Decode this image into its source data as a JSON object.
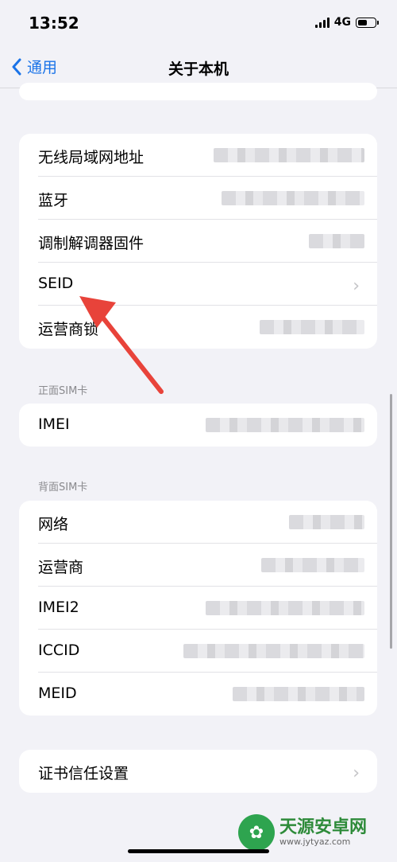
{
  "status": {
    "time": "13:52",
    "network": "4G"
  },
  "nav": {
    "back_label": "通用",
    "title": "关于本机"
  },
  "group1": {
    "rows": [
      {
        "label": "无线局域网地址"
      },
      {
        "label": "蓝牙"
      },
      {
        "label": "调制解调器固件"
      },
      {
        "label": "SEID"
      },
      {
        "label": "运营商锁"
      }
    ]
  },
  "section_front": "正面SIM卡",
  "group2": {
    "rows": [
      {
        "label": "IMEI"
      }
    ]
  },
  "section_back": "背面SIM卡",
  "group3": {
    "rows": [
      {
        "label": "网络"
      },
      {
        "label": "运营商"
      },
      {
        "label": "IMEI2"
      },
      {
        "label": "ICCID"
      },
      {
        "label": "MEID"
      }
    ]
  },
  "group4": {
    "rows": [
      {
        "label": "证书信任设置"
      }
    ]
  },
  "watermark": {
    "text": "天源安卓网",
    "url": "www.jytyaz.com"
  },
  "colors": {
    "accent": "#1a73e8",
    "arrow": "#e8433a"
  }
}
